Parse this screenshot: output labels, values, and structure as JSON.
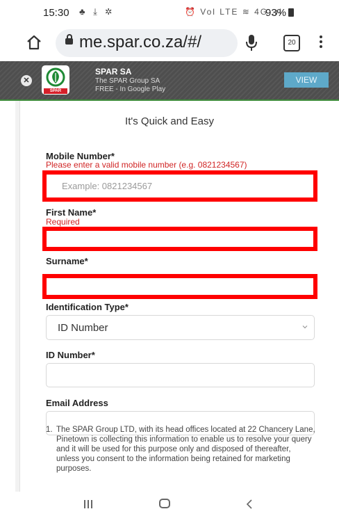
{
  "status_bar": {
    "time": "15:30",
    "left_icons": "♣ ⤓ ✲",
    "right_icons": "⏰ Vol LTE ≋ 4G .ıl",
    "battery": "93%"
  },
  "browser": {
    "url": "me.spar.co.za/#/",
    "tab_count": "20"
  },
  "app_banner": {
    "title": "SPAR SA",
    "publisher": "The SPAR Group SA",
    "price_store": "FREE - In Google Play",
    "view_label": "VIEW",
    "logo_text": "SPAR"
  },
  "form": {
    "subtitle": "It's Quick and Easy",
    "mobile": {
      "label": "Mobile Number*",
      "error": "Please enter a valid mobile number (e.g. 0821234567)",
      "placeholder": "Example: 0821234567"
    },
    "first_name": {
      "label": "First Name*",
      "error": "Required"
    },
    "surname": {
      "label": "Surname*"
    },
    "id_type": {
      "label": "Identification Type*",
      "value": "ID Number"
    },
    "id_number": {
      "label": "ID Number*"
    },
    "email": {
      "label": "Email Address"
    },
    "note": {
      "number": "1.",
      "text": "The SPAR Group LTD, with its head offices located at 22 Chancery Lane, Pinetown is collecting this information to enable us to resolve your query and it will be used for this purpose only and disposed of thereafter, unless you consent to the information being retained for marketing purposes."
    }
  },
  "colors": {
    "highlight": "#ff0000",
    "error_text": "#d02424",
    "banner_bg": "#4e4e4e",
    "view_button": "#5ea9c9",
    "brand_green": "#1f8a35"
  }
}
